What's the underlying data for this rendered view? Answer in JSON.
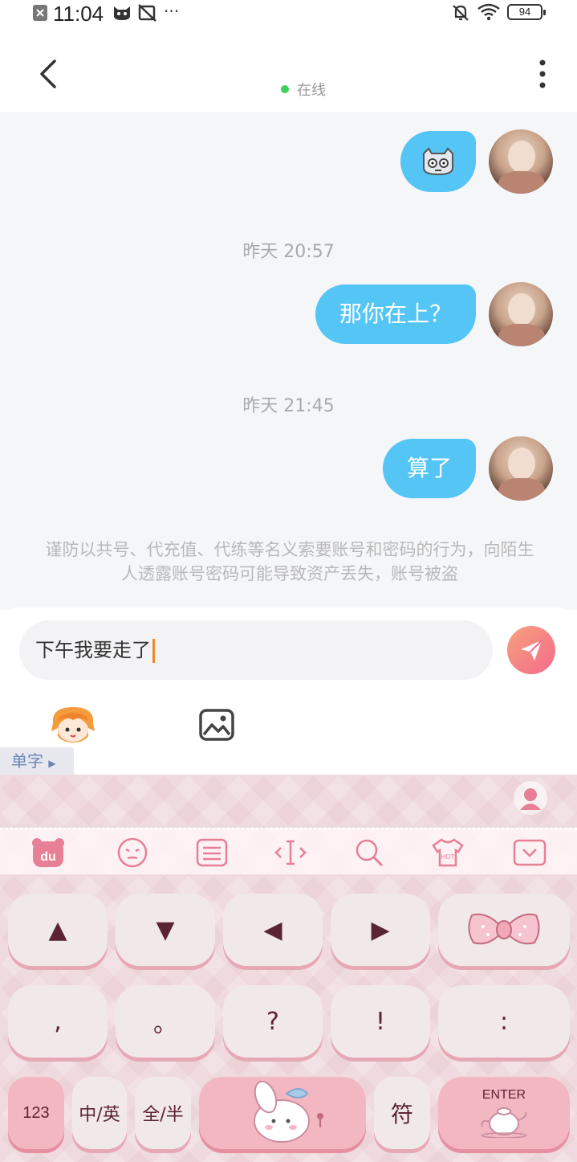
{
  "status_bar": {
    "time": "11:04",
    "more": "···",
    "battery": "94",
    "icons": [
      "notification-x-icon",
      "cat-icon",
      "no-photo-icon",
      "bell-off-icon",
      "wifi-icon",
      "battery-icon"
    ]
  },
  "header": {
    "status": "在线",
    "icons": [
      "back-icon",
      "more-vertical-icon"
    ]
  },
  "messages": [
    {
      "type": "sticker",
      "content": "cat-sticker"
    },
    {
      "type": "time",
      "text": "昨天 20:57"
    },
    {
      "type": "text",
      "text": "那你在上？"
    },
    {
      "type": "time",
      "text": "昨天 21:45"
    },
    {
      "type": "text",
      "text": "算了"
    }
  ],
  "notice": "谨防以共号、代充值、代练等名义索要账号和密码的行为，向陌生人透露账号密码可能导致资产丢失，账号被盗",
  "composer": {
    "input_value": "下午我要走了",
    "icons": [
      "send-icon",
      "emoji-icon",
      "image-icon"
    ]
  },
  "keyboard": {
    "single_char_label": "单字",
    "toolbar_icons": [
      "du-logo-icon",
      "emoticon-icon",
      "keyboard-icon",
      "cursor-move-icon",
      "search-icon",
      "shirt-hot-icon",
      "collapse-icon"
    ],
    "row1": [
      "▲",
      "▼",
      "◀",
      "▶"
    ],
    "row2": [
      ",",
      "。",
      "?",
      "!",
      ":"
    ],
    "row3": {
      "num_key": "123",
      "lang_key": "中/英",
      "width_key": "全/半",
      "symbol_key": "符",
      "enter_key": "ENTER"
    },
    "colors": {
      "accent": "#f36b8c",
      "bubble": "#55c5f6",
      "key_text": "#5a2434"
    }
  }
}
